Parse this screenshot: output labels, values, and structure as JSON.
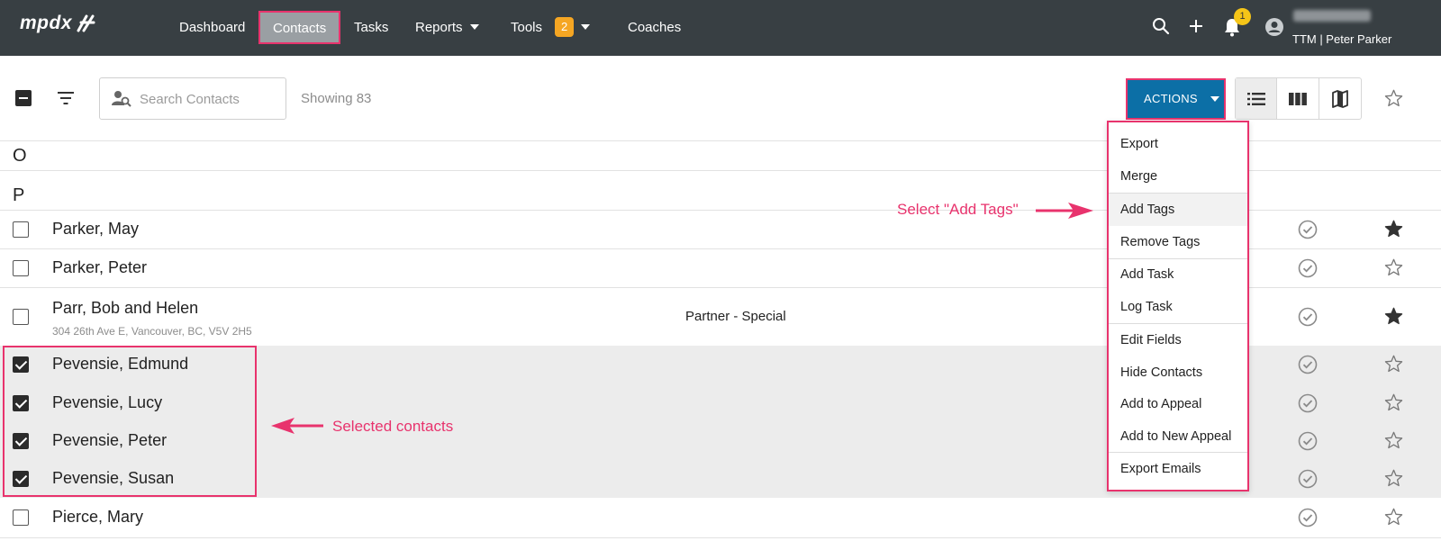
{
  "nav": {
    "logo": "mpdx",
    "items": [
      {
        "label": "Dashboard"
      },
      {
        "label": "Contacts"
      },
      {
        "label": "Tasks"
      },
      {
        "label": "Reports"
      },
      {
        "label": "Tools",
        "badge": "2"
      },
      {
        "label": "Coaches"
      }
    ],
    "notification_count": "1",
    "user_org": "TTM | Peter Parker"
  },
  "toolbar": {
    "search_placeholder": "Search Contacts",
    "showing": "Showing 83",
    "actions_label": "ACTIONS"
  },
  "list": {
    "letters": [
      "O",
      "P"
    ],
    "contacts": [
      {
        "name": "Parker, May",
        "address": "",
        "status": "",
        "selected": false,
        "starred": true
      },
      {
        "name": "Parker, Peter",
        "address": "",
        "status": "",
        "selected": false,
        "starred": false
      },
      {
        "name": "Parr, Bob and Helen",
        "address": "304 26th Ave E, Vancouver, BC, V5V 2H5",
        "status": "Partner - Special",
        "selected": false,
        "starred": true
      },
      {
        "name": "Pevensie, Edmund",
        "address": "",
        "status": "",
        "selected": true,
        "starred": false
      },
      {
        "name": "Pevensie, Lucy",
        "address": "",
        "status": "",
        "selected": true,
        "starred": false
      },
      {
        "name": "Pevensie, Peter",
        "address": "",
        "status": "",
        "selected": true,
        "starred": false
      },
      {
        "name": "Pevensie, Susan",
        "address": "",
        "status": "",
        "selected": true,
        "starred": false
      },
      {
        "name": "Pierce, Mary",
        "address": "",
        "status": "",
        "selected": false,
        "starred": false
      }
    ]
  },
  "actions_menu": {
    "items": [
      {
        "label": "Export"
      },
      {
        "label": "Merge"
      },
      {
        "label": "Add Tags"
      },
      {
        "label": "Remove Tags"
      },
      {
        "label": "Add Task"
      },
      {
        "label": "Log Task"
      },
      {
        "label": "Edit Fields"
      },
      {
        "label": "Hide Contacts"
      },
      {
        "label": "Add to Appeal"
      },
      {
        "label": "Add to New Appeal"
      },
      {
        "label": "Export Emails"
      }
    ]
  },
  "annotations": {
    "add_tags": "Select \"Add Tags\"",
    "selected": "Selected contacts"
  },
  "colors": {
    "nav_bg": "#383f43",
    "accent_pink": "#e8336d",
    "actions_blue": "#0c6fa6",
    "badge_orange": "#f5a623",
    "badge_yellow": "#f5c518"
  }
}
